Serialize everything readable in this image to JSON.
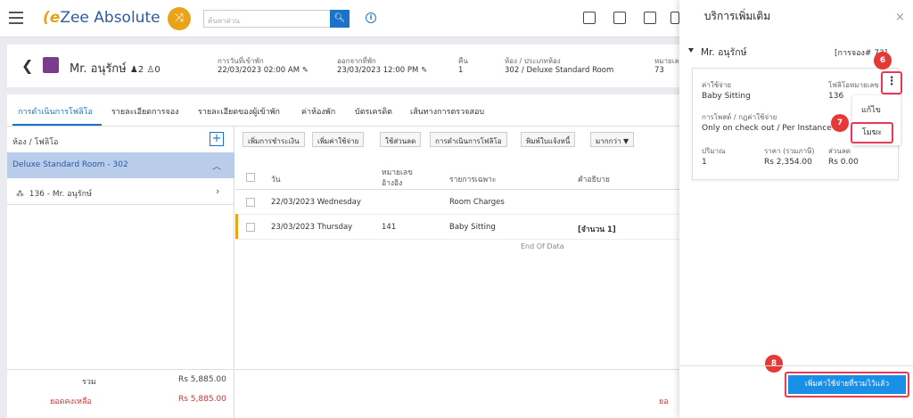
{
  "app": {
    "brand_e": "e",
    "brand_name": "Zee Absolute",
    "search_placeholder": "ค้นหาด่วน",
    "info": "i"
  },
  "booking_header": {
    "guest_name": "Mr. อนุรักษ์",
    "occupancy": "♟2 ♙0",
    "arrival_label": "การวันที่เข้าพัก",
    "arrival_value": "22/03/2023 02:00 AM",
    "departure_label": "ออกจากที่พัก",
    "departure_value": "23/03/2023 12:00 PM",
    "nights_label": "คืน",
    "nights_value": "1",
    "room_label": "ห้อง / ประเภทห้อง",
    "room_value": "302 / Deluxe Standard Room",
    "number_label": "หมายเล",
    "number_value": "73"
  },
  "tabs": [
    "การดำเนินการโฟลิโอ",
    "รายละเอียดการจอง",
    "รายละเอียดของผู้เข้าพัก",
    "ค่าห้องพัก",
    "บัตรเครดิต",
    "เส้นทางการตรวจสอบ"
  ],
  "left_pane": {
    "header": "ห้อง / โฟลิโอ",
    "add": "+",
    "room": "Deluxe Standard Room - 302",
    "folio": "136 - Mr. อนุรักษ์",
    "total_label": "รวม",
    "total_value": "Rs 5,885.00",
    "balance_label": "ยอดคงเหลือ",
    "balance_value": "Rs 5,885.00"
  },
  "toolbar": [
    "เพิ่มการชำระเงิน",
    "เพิ่มค่าใช้จ่าย",
    "ใช้ส่วนลด",
    "การดำเนินการโฟลิโอ",
    "พิมพ์ใบแจ้งหนี้",
    "มากกว่า ▼"
  ],
  "table": {
    "headers": {
      "day": "วัน",
      "ref_1": "หมายเลข",
      "ref_2": "อ้างอิง",
      "item": "รายการเฉพาะ",
      "desc": "คำอธิบาย"
    },
    "rows": [
      {
        "day": "22/03/2023 Wednesday",
        "ref": "",
        "item": "Room Charges",
        "desc": ""
      },
      {
        "day": "23/03/2023 Thursday",
        "ref": "141",
        "item": "Baby Sitting",
        "desc": "[จำนวน 1]"
      }
    ],
    "end_text": "End Of Data",
    "footer_red": "ยอ"
  },
  "panel": {
    "title": "บริการเพิ่มเติม",
    "close": "×",
    "guest": "Mr. อนุรักษ์",
    "reservation": "[การจอง# 73]",
    "charge_label": "ค่าใช้จ่าย",
    "charge_value": "Baby Sitting",
    "folio_label": "โฟลิโอหมายเลข",
    "folio_value": "136",
    "rule_label": "การโพสต์ / กฎค่าใช้จ่าย",
    "rule_value": "Only on check out / Per Instance",
    "qty_label": "ปริมาณ",
    "qty_value": "1",
    "price_label": "ราคา (รวมภาษี)",
    "price_value": "Rs 2,354.00",
    "discount_label": "ส่วนลด",
    "discount_value": "Rs 0.00",
    "menu_edit": "แก้ไข",
    "menu_void": "โมฆะ",
    "kebab": "⋮",
    "bottom_button": "เพิ่มค่าใช้จ่ายที่รวมไว้แล้ว",
    "badges": [
      "6",
      "7",
      "8"
    ]
  },
  "colors": {
    "accent": "#1a73c8",
    "highlight": "#e53955",
    "badge": "#e53935",
    "room_row": "#b9cdea"
  }
}
